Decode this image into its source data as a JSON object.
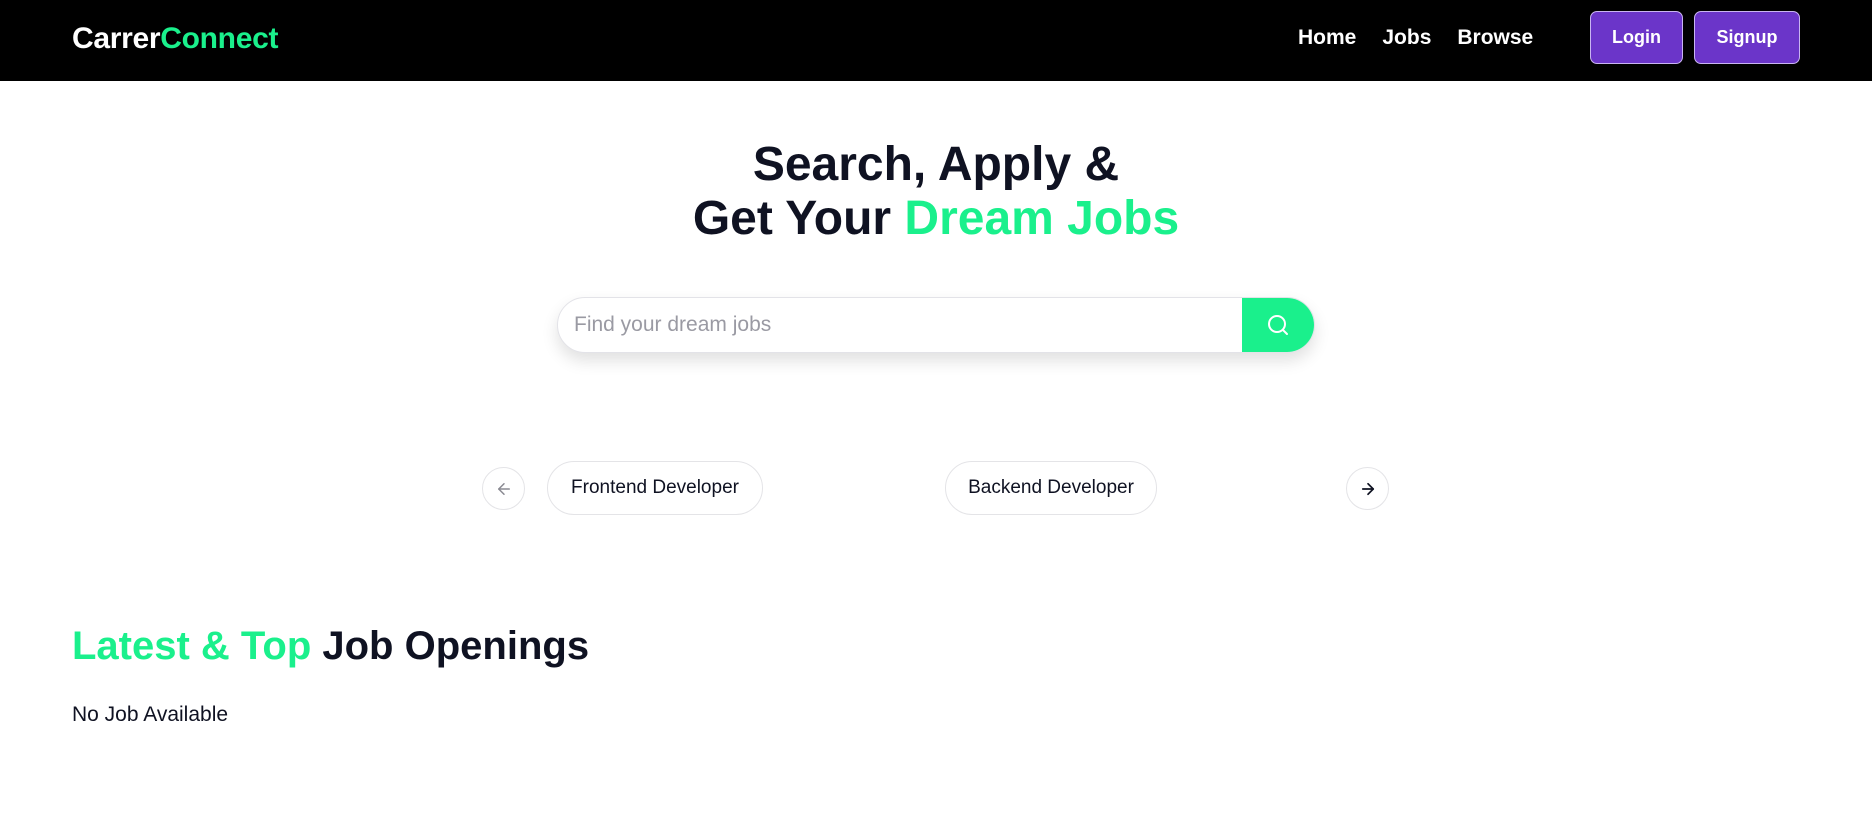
{
  "navbar": {
    "brand_part1": "Carrer",
    "brand_part2": "Connect",
    "links": [
      "Home",
      "Jobs",
      "Browse"
    ],
    "login_label": "Login",
    "signup_label": "Signup"
  },
  "hero": {
    "title_line1": "Search, Apply &",
    "title_line2_prefix": "Get Your ",
    "title_line2_accent": "Dream Jobs"
  },
  "search": {
    "placeholder": "Find your dream jobs",
    "value": "",
    "icon": "search-icon"
  },
  "carousel": {
    "prev_icon": "arrow-left-icon",
    "next_icon": "arrow-right-icon",
    "categories": [
      "Frontend Developer",
      "Backend Developer"
    ]
  },
  "jobs_section": {
    "title_accent": "Latest & Top",
    "title_rest": " Job Openings",
    "empty_message": "No Job Available"
  },
  "colors": {
    "accent": "#1af08c",
    "button": "#6b35c9",
    "navbar_bg": "#000000"
  }
}
